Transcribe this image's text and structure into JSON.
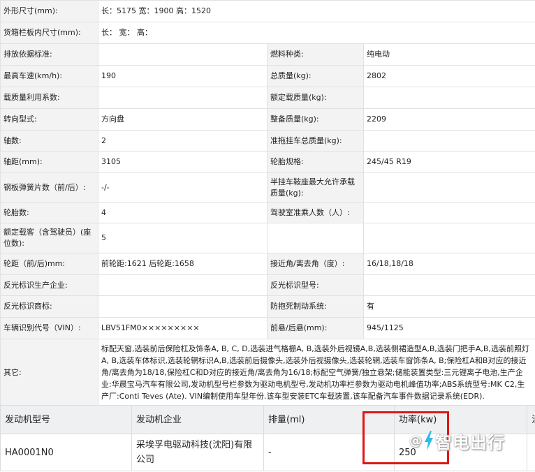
{
  "spec": {
    "dimensions": {
      "label": "外形尺寸(mm):",
      "value": "长：5175 宽：1900 高：1520"
    },
    "cargo_box": {
      "label": "货箱栏板内尺寸(mm):",
      "value": "长： 宽： 高："
    },
    "rows": [
      {
        "l1": "排放依据标准:",
        "v1": "",
        "l2": "燃料种类:",
        "v2": "纯电动"
      },
      {
        "l1": "最高车速(km/h):",
        "v1": "190",
        "l2": "总质量(kg):",
        "v2": "2802"
      },
      {
        "l1": "载质量利用系数:",
        "v1": "",
        "l2": "额定载质量(kg):",
        "v2": ""
      },
      {
        "l1": "转向型式:",
        "v1": "方向盘",
        "l2": "整备质量(kg):",
        "v2": "2209"
      },
      {
        "l1": "轴数:",
        "v1": "2",
        "l2": "准拖挂车总质量(kg):",
        "v2": ""
      },
      {
        "l1": "轴距(mm):",
        "v1": "3105",
        "l2": "轮胎规格:",
        "v2": "245/45 R19"
      },
      {
        "l1": "钢板弹簧片数（前/后）:",
        "v1": "-/-",
        "l2": "半挂车鞍座最大允许承载质量(kg):",
        "v2": ""
      },
      {
        "l1": "轮胎数:",
        "v1": "4",
        "l2": "驾驶室准乘人数（人）:",
        "v2": ""
      },
      {
        "l1": "额定载客（含驾驶员）(座位数):",
        "v1": "5",
        "l2": "",
        "v2": ""
      },
      {
        "l1": "轮距（前/后)mm:",
        "v1": "前轮距:1621 后轮距:1658",
        "l2": "接近角/离去角（度）:",
        "v2": "16/18,18/18"
      },
      {
        "l1": "反光标识生产企业:",
        "v1": "",
        "l2": "反光标识型号:",
        "v2": ""
      },
      {
        "l1": "反光标识商标:",
        "v1": "",
        "l2": "防抱死制动系统:",
        "v2": "有"
      },
      {
        "l1": "车辆识别代号（VIN）:",
        "v1": "LBV51FM0×××××××××",
        "l2": "前悬/后悬(mm):",
        "v2": "945/1125"
      }
    ],
    "other": {
      "label": "其它:",
      "value": "标配天窗,选装前后保险杠及饰条A, B, C, D,选装进气格栅A, B,选装外后视镜A,B,选装侧裙造型A,B,选装门把手A,B,选装前照灯A, B,选装车体标识,选装轮辋标识A,B,选装前后摄像头,选装外后视摄像头,选装轮辋,选装车窗饰条A, B;保险杠A和B对应的接近角/离去角为18/18,保险杠C和D对应的接近角/离去角为16/18;标配空气弹簧/独立悬架;储能装置类型:三元锂离子电池,生产企业:华晨宝马汽车有限公司,发动机型号栏参数为驱动电机型号,发动机功率栏参数为驱动电机峰值功率;ABS系统型号:MK C2,生产厂:Conti Teves (Ate). VIN编制使用车型年份.该车型安装ETC车载装置,该车配备汽车事件数据记录系统(EDR)."
    }
  },
  "engine_table": {
    "headers": [
      "发动机型号",
      "发动机企业",
      "排量(ml)",
      "功率(kw)",
      "油"
    ],
    "row": [
      "HA0001N0",
      "采埃孚电驱动科技(沈阳)有限公司",
      "-",
      "250",
      ""
    ]
  },
  "watermark": {
    "at": "@",
    "text": "智电出行",
    "icon": "lightning-bolt-icon"
  },
  "colors": {
    "highlight": "#e01616",
    "label_bg": "#f3f3f3",
    "header_bg": "#eef0f1",
    "bolt": "#1fb6e8"
  }
}
